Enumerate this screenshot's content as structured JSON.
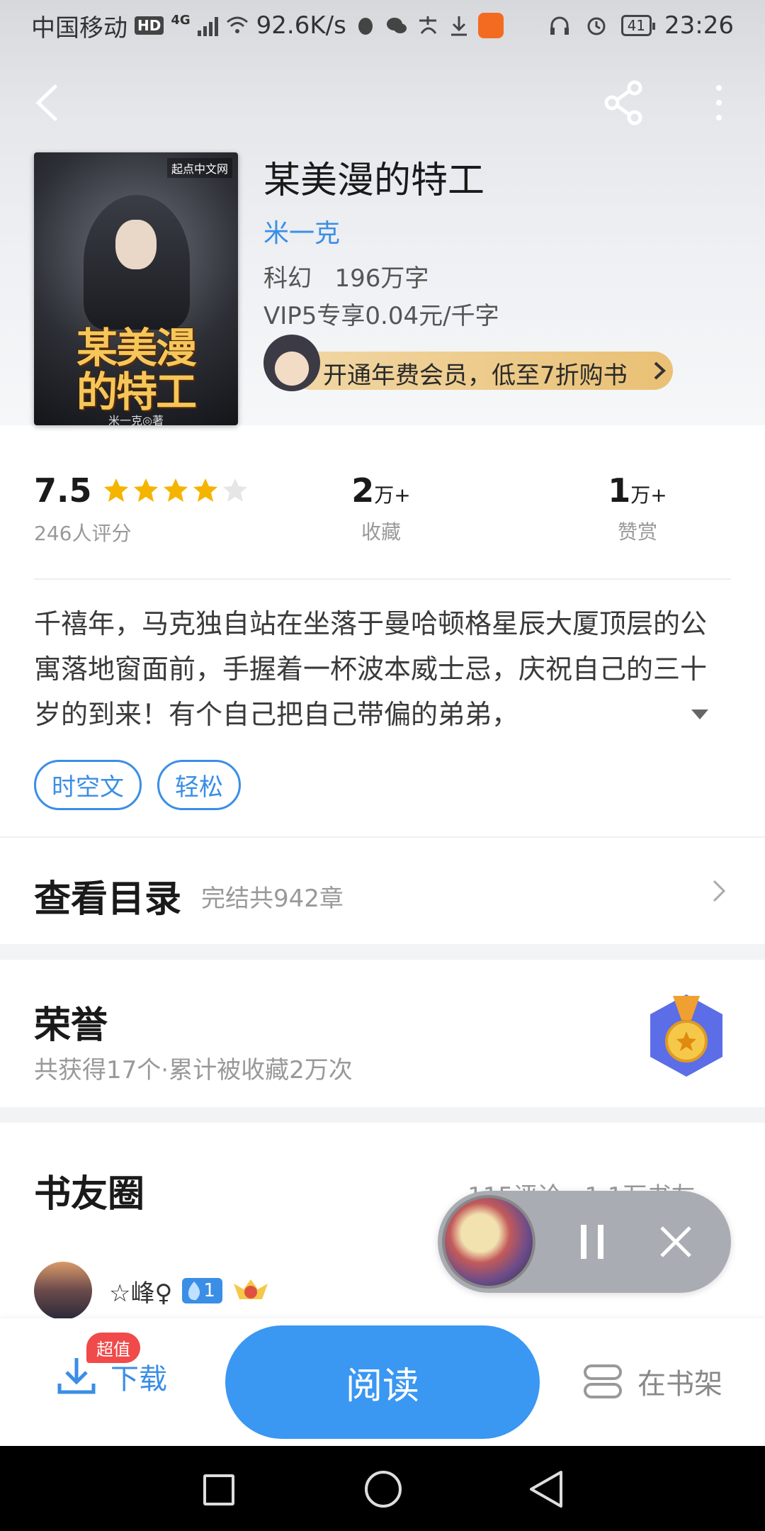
{
  "status_bar": {
    "carrier": "中国移动",
    "hd": "HD",
    "network": "4G",
    "speed": "92.6K/s",
    "battery": "41",
    "time": "23:26",
    "icons": [
      "qq-icon",
      "wechat-icon",
      "alipay-icon",
      "download-icon",
      "uc-icon",
      "headphones-icon",
      "alarm-icon"
    ]
  },
  "nav": {
    "back_icon": "back-arrow-icon",
    "share_icon": "share-icon",
    "more_icon": "more-icon"
  },
  "book": {
    "title": "某美漫的特工",
    "author": "米一克",
    "category": "科幻",
    "word_count": "196万字",
    "price": "VIP5专享0.04元/千字",
    "cover": {
      "publisher": "起点中文网",
      "title_line1": "某美漫",
      "title_line2": "的特工",
      "author": "米一克◎著"
    }
  },
  "vip_banner": {
    "text": "开通年费会员，低至7折购书"
  },
  "stats": {
    "rating": "7.5",
    "rating_stars": 4,
    "rating_stars_max": 5,
    "rating_count": "246人评分",
    "favorites_num": "2",
    "favorites_unit": "万+",
    "favorites_label": "收藏",
    "reward_num": "1",
    "reward_unit": "万+",
    "reward_label": "赞赏"
  },
  "synopsis": "千禧年，马克独自站在坐落于曼哈顿格星辰大厦顶层的公寓落地窗面前，手握着一杯波本威士忌，庆祝自己的三十岁的到来！有个自己把自己带偏的弟弟，",
  "tags": [
    "时空文",
    "轻松"
  ],
  "catalog": {
    "title": "查看目录",
    "subtitle": "完结共942章"
  },
  "honor": {
    "title": "荣誉",
    "subtitle": "共获得17个·累计被收藏2万次"
  },
  "circle": {
    "title": "书友圈",
    "meta": "115评论 · 1.1万书友",
    "user": {
      "name": "☆峰♀",
      "level": "1",
      "badge": "5"
    }
  },
  "bottom_bar": {
    "download_label": "下载",
    "download_badge": "超值",
    "read_label": "阅读",
    "shelf_label": "在书架"
  },
  "colors": {
    "accent": "#3a8ee6",
    "read_button": "#3a97f2",
    "star": "#f5b400",
    "vip_gold": "#e9c074",
    "badge_red": "#f04a4a"
  }
}
